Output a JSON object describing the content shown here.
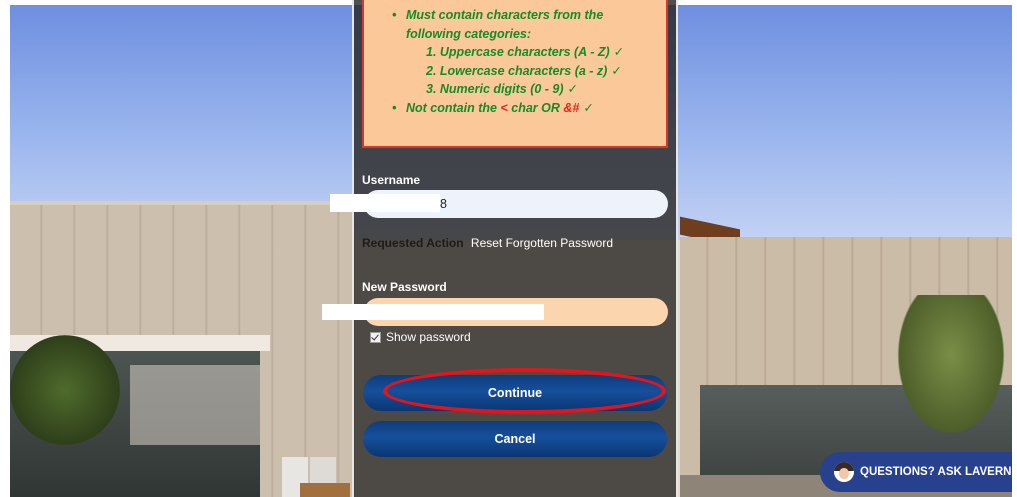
{
  "password_rules": {
    "categories_intro_line1": "Must contain characters from the",
    "categories_intro_line2": "following categories:",
    "items": [
      "1. Uppercase characters (A - Z)",
      "2. Lowercase characters (a - z)",
      "3. Numeric digits (0 - 9)"
    ],
    "exclusion_prefix": "Not contain the",
    "exclusion_char1": "<",
    "exclusion_mid": "char OR",
    "exclusion_char2": "&#",
    "check_glyph": "✓"
  },
  "form": {
    "username_label": "Username",
    "username_value_visible": "8",
    "requested_action_label": "Requested Action",
    "requested_action_value": "Reset Forgotten Password",
    "new_password_label": "New Password",
    "show_password_label": "Show password",
    "show_password_checked": true
  },
  "buttons": {
    "continue_label": "Continue",
    "cancel_label": "Cancel"
  },
  "chat_widget": {
    "label": "QUESTIONS? ASK LAVERN"
  },
  "colors": {
    "rules_bg": "#fbc89a",
    "rules_text": "#168b26",
    "button_blue": "#174f9c",
    "annotation_red": "#e5141b",
    "chat_bg": "#27418f"
  }
}
